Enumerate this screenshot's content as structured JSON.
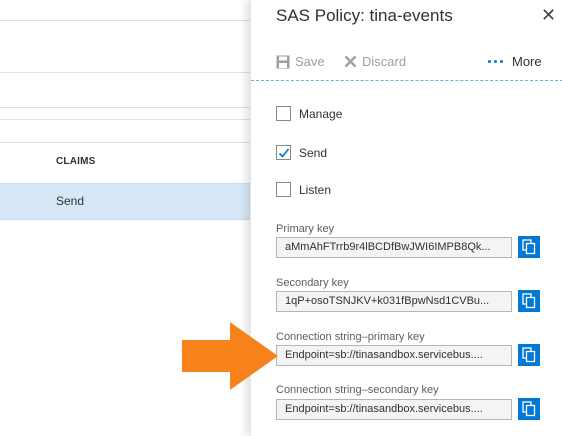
{
  "background": {
    "claims_header": "CLAIMS",
    "claims_value": "Send"
  },
  "blade": {
    "title": "SAS Policy: tina-events",
    "toolbar": {
      "save_label": "Save",
      "discard_label": "Discard",
      "more_label": "More"
    },
    "claims": [
      {
        "label": "Manage",
        "checked": false
      },
      {
        "label": "Send",
        "checked": true
      },
      {
        "label": "Listen",
        "checked": false
      }
    ],
    "keys": [
      {
        "label": "Primary key",
        "value": "aMmAhFTrrb9r4lBCDfBwJWI6IMPB8Qk..."
      },
      {
        "label": "Secondary key",
        "value": "1qP+osoTSNJKV+k031fBpwNsd1CVBu..."
      },
      {
        "label": "Connection string–primary key",
        "value": "Endpoint=sb://tinasandbox.servicebus...."
      },
      {
        "label": "Connection string–secondary key",
        "value": "Endpoint=sb://tinasandbox.servicebus...."
      }
    ]
  },
  "colors": {
    "accent": "#0078d4",
    "arrow": "#f7821b",
    "selected_row": "#d6e8f7"
  },
  "icons": {
    "close": "close-icon",
    "save": "save-icon",
    "discard": "discard-icon",
    "more": "more-icon",
    "copy": "copy-icon",
    "check": "checkmark-icon",
    "arrow": "arrow-icon"
  }
}
